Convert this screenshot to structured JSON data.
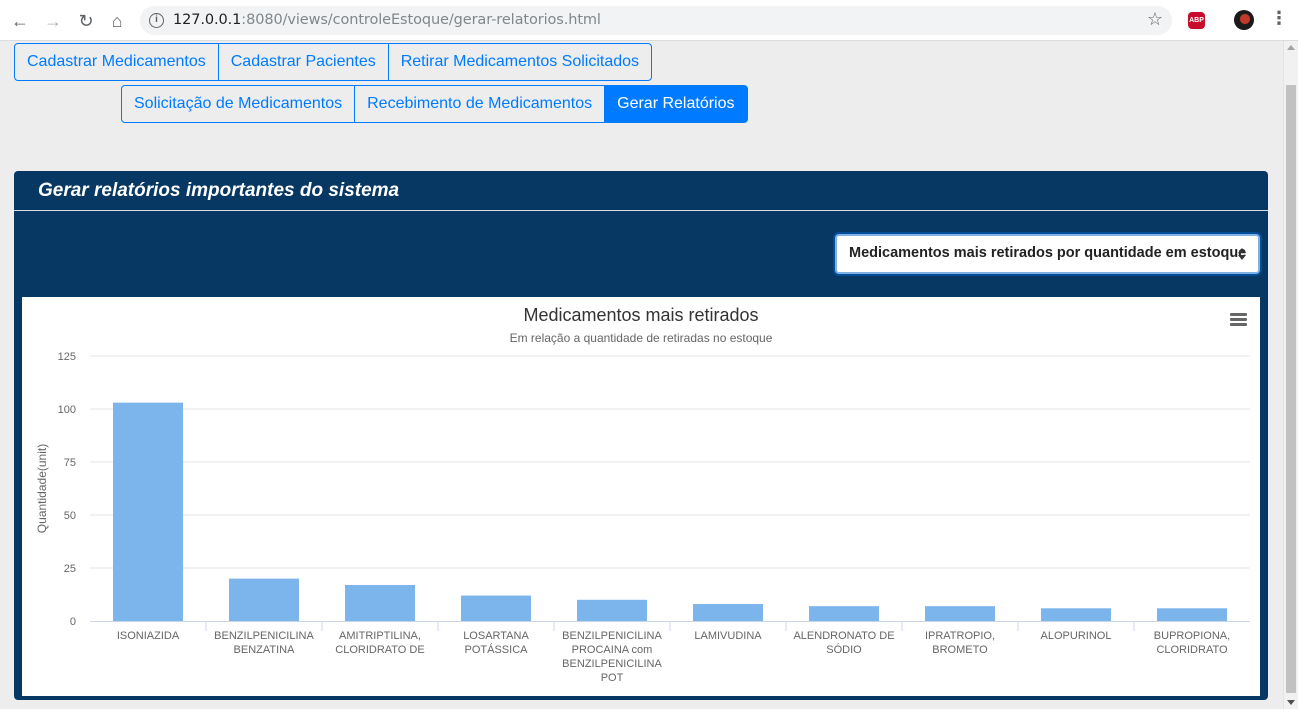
{
  "browser": {
    "url_host": "127.0.0.1",
    "url_rest": ":8080/views/controleEstoque/gerar-relatorios.html",
    "abp_label": "ABP"
  },
  "nav_row1": [
    {
      "label": "Cadastrar Medicamentos",
      "active": false
    },
    {
      "label": "Cadastrar Pacientes",
      "active": false
    },
    {
      "label": "Retirar Medicamentos Solicitados",
      "active": false
    }
  ],
  "nav_row2": [
    {
      "label": "Solicitação de Medicamentos",
      "active": false
    },
    {
      "label": "Recebimento de Medicamentos",
      "active": false
    },
    {
      "label": "Gerar Relatórios",
      "active": true
    }
  ],
  "panel": {
    "title": "Gerar relatórios importantes do sistema",
    "select_value": "Medicamentos mais retirados por quantidade em estoque"
  },
  "colors": {
    "accent": "#007bff",
    "panel_bg": "#073763",
    "bar": "#7cb5ec"
  },
  "chart_data": {
    "type": "bar",
    "title": "Medicamentos mais retirados",
    "subtitle": "Em relação a quantidade de retiradas no estoque",
    "ylabel": "Quantidade(unit)",
    "xlabel": "",
    "ylim": [
      0,
      125
    ],
    "yticks": [
      0,
      25,
      50,
      75,
      100,
      125
    ],
    "grid": true,
    "categories": [
      [
        "ISONIAZIDA"
      ],
      [
        "BENZILPENICILINA",
        "BENZATINA"
      ],
      [
        "AMITRIPTILINA,",
        "CLORIDRATO DE"
      ],
      [
        "LOSARTANA",
        "POTÁSSICA"
      ],
      [
        "BENZILPENICILINA",
        "PROCAINA com",
        "BENZILPENICILINA",
        "POT"
      ],
      [
        "LAMIVUDINA"
      ],
      [
        "ALENDRONATO DE",
        "SÓDIO"
      ],
      [
        "IPRATROPIO,",
        "BROMETO"
      ],
      [
        "ALOPURINOL"
      ],
      [
        "BUPROPIONA,",
        "CLORIDRATO"
      ]
    ],
    "values": [
      103,
      20,
      17,
      12,
      10,
      8,
      7,
      7,
      6,
      6
    ]
  }
}
